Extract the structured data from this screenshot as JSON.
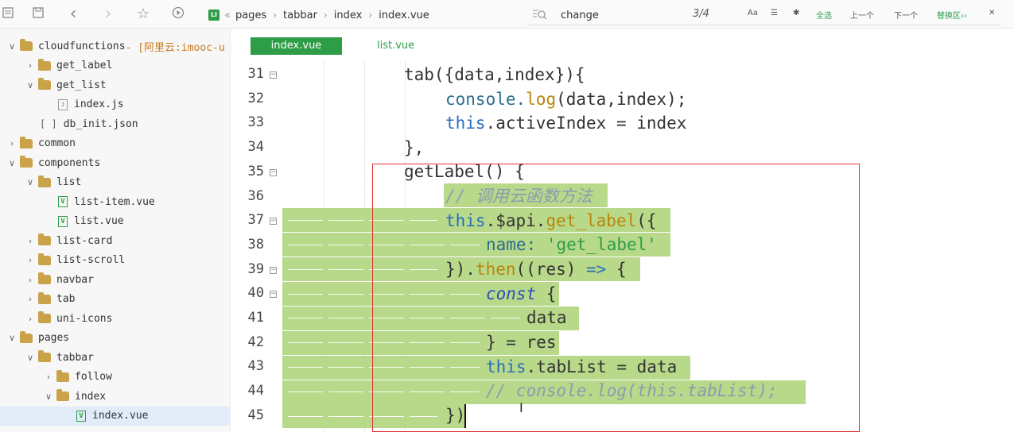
{
  "toolbar": {
    "icons": [
      "list-icon",
      "save-icon",
      "back-icon",
      "forward-icon",
      "star-icon",
      "run-icon"
    ],
    "back_glyph": "‹",
    "forward_glyph": "›",
    "star_glyph": "☆",
    "run_glyph": "▶",
    "breadcrumb": {
      "badge": "LI",
      "root_sep": "«",
      "items": [
        "pages",
        "tabbar",
        "index",
        "index.vue"
      ],
      "sep": "›"
    },
    "search": {
      "value": "change",
      "count": "3/4",
      "btn_case": "Aa",
      "btn_word": "☰",
      "btn_regex": "✱",
      "btn_all": "全选",
      "btn_prev": "上一个",
      "btn_next": "下一个",
      "btn_replace": "替换区‹‹",
      "btn_close": "✕"
    }
  },
  "sidebar": {
    "items": [
      {
        "label": "cloudfunctions",
        "note": " - [阿里云:imooc-u",
        "chev": "∨",
        "kind": "folder",
        "indent": 0
      },
      {
        "label": "get_label",
        "chev": "›",
        "kind": "folder",
        "indent": 1
      },
      {
        "label": "get_list",
        "chev": "∨",
        "kind": "folder",
        "indent": 1
      },
      {
        "label": "index.js",
        "chev": "",
        "kind": "js",
        "indent": 2
      },
      {
        "label": "db_init.json",
        "chev": "",
        "kind": "json",
        "indent": 1
      },
      {
        "label": "common",
        "chev": "›",
        "kind": "folder",
        "indent": 0
      },
      {
        "label": "components",
        "chev": "∨",
        "kind": "folder",
        "indent": 0
      },
      {
        "label": "list",
        "chev": "∨",
        "kind": "folder",
        "indent": 1
      },
      {
        "label": "list-item.vue",
        "chev": "",
        "kind": "vue",
        "indent": 2
      },
      {
        "label": "list.vue",
        "chev": "",
        "kind": "vue",
        "indent": 2
      },
      {
        "label": "list-card",
        "chev": "›",
        "kind": "folder",
        "indent": 1
      },
      {
        "label": "list-scroll",
        "chev": "›",
        "kind": "folder",
        "indent": 1
      },
      {
        "label": "navbar",
        "chev": "›",
        "kind": "folder",
        "indent": 1
      },
      {
        "label": "tab",
        "chev": "›",
        "kind": "folder",
        "indent": 1
      },
      {
        "label": "uni-icons",
        "chev": "›",
        "kind": "folder",
        "indent": 1
      },
      {
        "label": "pages",
        "chev": "∨",
        "kind": "folder",
        "indent": 0
      },
      {
        "label": "tabbar",
        "chev": "∨",
        "kind": "folder",
        "indent": 1
      },
      {
        "label": "follow",
        "chev": "›",
        "kind": "folder",
        "indent": 2
      },
      {
        "label": "index",
        "chev": "∨",
        "kind": "folder",
        "indent": 2
      },
      {
        "label": "index.vue",
        "chev": "",
        "kind": "vue",
        "indent": 3,
        "selected": true
      }
    ],
    "json_glyph": "[ ]",
    "js_glyph": "J",
    "vue_glyph": "V"
  },
  "tabs": [
    {
      "label": "index.vue",
      "active": true
    },
    {
      "label": "list.vue",
      "active": false
    }
  ],
  "editor": {
    "lines": [
      {
        "n": "31",
        "fold": "⊟"
      },
      {
        "n": "32",
        "fold": ""
      },
      {
        "n": "33",
        "fold": ""
      },
      {
        "n": "34",
        "fold": ""
      },
      {
        "n": "35",
        "fold": "⊟"
      },
      {
        "n": "36",
        "fold": ""
      },
      {
        "n": "37",
        "fold": "⊟"
      },
      {
        "n": "38",
        "fold": ""
      },
      {
        "n": "39",
        "fold": "⊟"
      },
      {
        "n": "40",
        "fold": "⊟"
      },
      {
        "n": "41",
        "fold": ""
      },
      {
        "n": "42",
        "fold": ""
      },
      {
        "n": "43",
        "fold": ""
      },
      {
        "n": "44",
        "fold": ""
      },
      {
        "n": "45",
        "fold": ""
      }
    ],
    "code": {
      "l31": "tab({data,index}){",
      "l32_a": "console.",
      "l32_b": "log",
      "l32_c": "(data,index);",
      "l33_a": "this",
      "l33_b": ".activeIndex = index",
      "l34": "},",
      "l35": "getLabel() {",
      "l36": "// 调用云函数方法",
      "l37_a": "this",
      "l37_b": ".$api.",
      "l37_c": "get_label",
      "l37_d": "({",
      "l38_a": "name:",
      "l38_b": " 'get_label'",
      "l39_a": "}).",
      "l39_b": "then",
      "l39_c": "((res) ",
      "l39_d": "=>",
      "l39_e": " {",
      "l40_a": "const",
      "l40_b": " {",
      "l41": "data",
      "l42": "} = res",
      "l43_a": "this",
      "l43_b": ".tabList = data",
      "l44": "// console.log(this.tabList);",
      "l45": "})"
    }
  },
  "colors": {
    "accent": "#2e9d47",
    "selection": "#b8d88a",
    "highlight_box": "#e03030",
    "keyword": "#2a6ebb",
    "function": "#b7860b",
    "comment": "#8c9bb0"
  }
}
